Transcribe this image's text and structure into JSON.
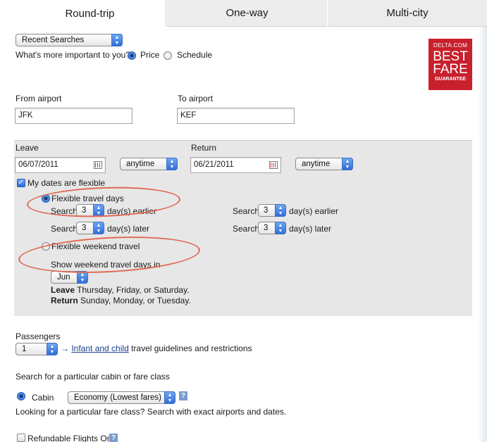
{
  "tabs": {
    "roundtrip": "Round-trip",
    "oneway": "One-way",
    "multicity": "Multi-city"
  },
  "recent_searches": "Recent Searches",
  "importance": {
    "question": "What's more important to you?",
    "price": "Price",
    "schedule": "Schedule"
  },
  "badge": {
    "top": "DELTA.COM",
    "line1": "BEST",
    "line2": "FARE",
    "line3": "GUARANTEE"
  },
  "from": {
    "label": "From airport",
    "value": "JFK"
  },
  "to": {
    "label": "To airport",
    "value": "KEF"
  },
  "leave": {
    "label": "Leave",
    "date": "06/07/2011",
    "time": "anytime"
  },
  "return": {
    "label": "Return",
    "date": "06/21/2011",
    "time": "anytime"
  },
  "flexible": {
    "dates_label": "My dates are flexible",
    "travel_days": "Flexible travel days",
    "search": "Search",
    "earlier_value": "3",
    "earlier_label": "day(s) earlier",
    "later_value": "3",
    "later_label": "day(s) later",
    "ret_earlier_value": "3",
    "ret_later_value": "3",
    "weekend": "Flexible weekend travel",
    "show_weekend": "Show weekend travel days in",
    "month": "Jun",
    "leave_bold": "Leave",
    "leave_days": " Thursday, Friday, or Saturday.",
    "return_bold": "Return",
    "return_days": " Sunday, Monday, or Tuesday."
  },
  "passengers": {
    "label": "Passengers",
    "value": "1",
    "arrow": "→",
    "link": "Infant and child",
    "suffix": " travel guidelines and restrictions"
  },
  "cabin": {
    "section_label": "Search for a particular cabin or fare class",
    "cabin_label": "Cabin",
    "cabin_value": "Economy (Lowest fares)",
    "help": "?",
    "fare_note": "Looking for a particular fare class? Search with exact airports and dates."
  },
  "refundable": {
    "label": "Refundable Flights Only",
    "help": "?"
  },
  "colors": {
    "badge": "#c8202c",
    "annotation": "#e06a55",
    "accent": "#2f6ed9"
  }
}
